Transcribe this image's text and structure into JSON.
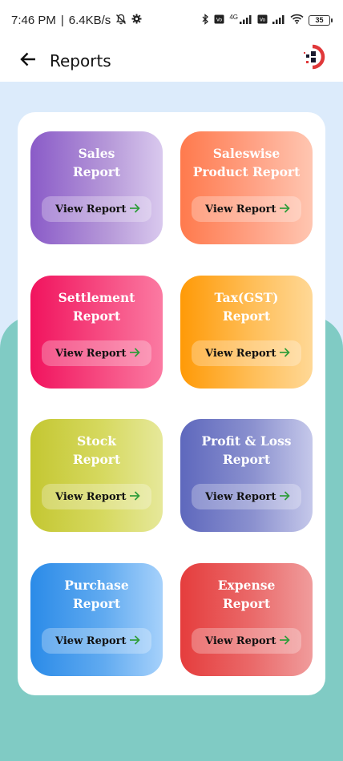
{
  "status_bar": {
    "time": "7:46 PM",
    "net_speed": "6.4KB/s",
    "battery": "35",
    "network_label": "4G"
  },
  "app_bar": {
    "title": "Reports"
  },
  "tiles": [
    {
      "title": "Sales\nReport",
      "button": "View Report"
    },
    {
      "title": "Saleswise\nProduct Report",
      "button": "View Report"
    },
    {
      "title": "Settlement\nReport",
      "button": "View Report"
    },
    {
      "title": "Tax(GST)\nReport",
      "button": "View Report"
    },
    {
      "title": "Stock\nReport",
      "button": "View Report"
    },
    {
      "title": "Profit & Loss\nReport",
      "button": "View Report"
    },
    {
      "title": "Purchase\nReport",
      "button": "View Report"
    },
    {
      "title": "Expense\nReport",
      "button": "View Report"
    }
  ],
  "icons": {
    "back": "arrow-left-icon",
    "arrow": "arrow-right-icon",
    "logo": "app-logo"
  },
  "colors": {
    "page_background": "#dcebfb",
    "teal_background": "#80cbc4",
    "arrow_green": "#2e9d3a"
  }
}
